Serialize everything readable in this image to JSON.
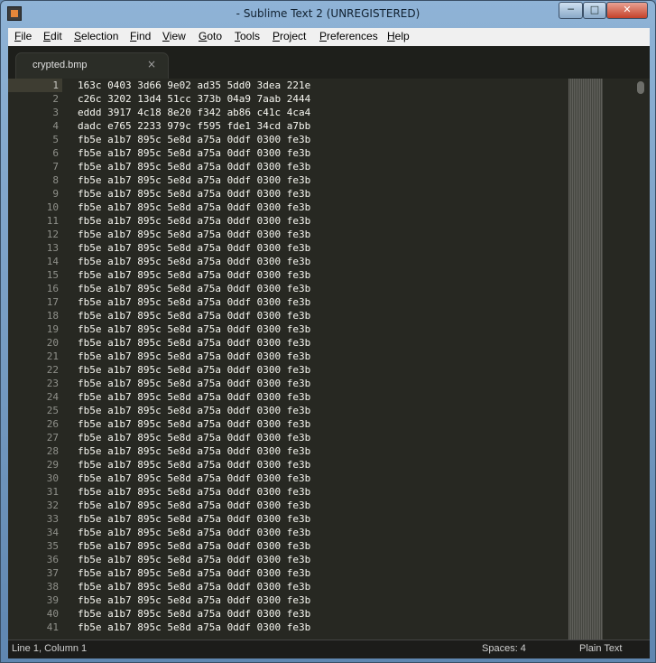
{
  "window": {
    "title": "- Sublime Text 2 (UNREGISTERED)",
    "controls": {
      "minimize": "─",
      "maximize": "□",
      "close": "✕"
    }
  },
  "menu": [
    {
      "label": "File",
      "mnemonic": "F",
      "rest": "ile"
    },
    {
      "label": "Edit",
      "mnemonic": "E",
      "rest": "dit"
    },
    {
      "label": "Selection",
      "mnemonic": "S",
      "rest": "election"
    },
    {
      "label": "Find",
      "mnemonic": "F",
      "rest": "ind"
    },
    {
      "label": "View",
      "mnemonic": "V",
      "rest": "iew"
    },
    {
      "label": "Goto",
      "mnemonic": "G",
      "rest": "oto"
    },
    {
      "label": "Tools",
      "mnemonic": "T",
      "rest": "ools"
    },
    {
      "label": "Project",
      "mnemonic": "P",
      "rest": "roject"
    },
    {
      "label": "Preferences",
      "mnemonic": "P",
      "rest": "references"
    },
    {
      "label": "Help",
      "mnemonic": "H",
      "rest": "elp"
    }
  ],
  "tab": {
    "label": "crypted.bmp",
    "close": "×"
  },
  "editor": {
    "lines": [
      {
        "n": "1",
        "text": "163c 0403 3d66 9e02 ad35 5dd0 3dea 221e"
      },
      {
        "n": "2",
        "text": "c26c 3202 13d4 51cc 373b 04a9 7aab 2444"
      },
      {
        "n": "3",
        "text": "eddd 3917 4c18 8e20 f342 ab86 c41c 4ca4"
      },
      {
        "n": "4",
        "text": "dadc e765 2233 979c f595 fde1 34cd a7bb"
      },
      {
        "n": "5",
        "text": "fb5e a1b7 895c 5e8d a75a 0ddf 0300 fe3b"
      },
      {
        "n": "6",
        "text": "fb5e a1b7 895c 5e8d a75a 0ddf 0300 fe3b"
      },
      {
        "n": "7",
        "text": "fb5e a1b7 895c 5e8d a75a 0ddf 0300 fe3b"
      },
      {
        "n": "8",
        "text": "fb5e a1b7 895c 5e8d a75a 0ddf 0300 fe3b"
      },
      {
        "n": "9",
        "text": "fb5e a1b7 895c 5e8d a75a 0ddf 0300 fe3b"
      },
      {
        "n": "10",
        "text": "fb5e a1b7 895c 5e8d a75a 0ddf 0300 fe3b"
      },
      {
        "n": "11",
        "text": "fb5e a1b7 895c 5e8d a75a 0ddf 0300 fe3b"
      },
      {
        "n": "12",
        "text": "fb5e a1b7 895c 5e8d a75a 0ddf 0300 fe3b"
      },
      {
        "n": "13",
        "text": "fb5e a1b7 895c 5e8d a75a 0ddf 0300 fe3b"
      },
      {
        "n": "14",
        "text": "fb5e a1b7 895c 5e8d a75a 0ddf 0300 fe3b"
      },
      {
        "n": "15",
        "text": "fb5e a1b7 895c 5e8d a75a 0ddf 0300 fe3b"
      },
      {
        "n": "16",
        "text": "fb5e a1b7 895c 5e8d a75a 0ddf 0300 fe3b"
      },
      {
        "n": "17",
        "text": "fb5e a1b7 895c 5e8d a75a 0ddf 0300 fe3b"
      },
      {
        "n": "18",
        "text": "fb5e a1b7 895c 5e8d a75a 0ddf 0300 fe3b"
      },
      {
        "n": "19",
        "text": "fb5e a1b7 895c 5e8d a75a 0ddf 0300 fe3b"
      },
      {
        "n": "20",
        "text": "fb5e a1b7 895c 5e8d a75a 0ddf 0300 fe3b"
      },
      {
        "n": "21",
        "text": "fb5e a1b7 895c 5e8d a75a 0ddf 0300 fe3b"
      },
      {
        "n": "22",
        "text": "fb5e a1b7 895c 5e8d a75a 0ddf 0300 fe3b"
      },
      {
        "n": "23",
        "text": "fb5e a1b7 895c 5e8d a75a 0ddf 0300 fe3b"
      },
      {
        "n": "24",
        "text": "fb5e a1b7 895c 5e8d a75a 0ddf 0300 fe3b"
      },
      {
        "n": "25",
        "text": "fb5e a1b7 895c 5e8d a75a 0ddf 0300 fe3b"
      },
      {
        "n": "26",
        "text": "fb5e a1b7 895c 5e8d a75a 0ddf 0300 fe3b"
      },
      {
        "n": "27",
        "text": "fb5e a1b7 895c 5e8d a75a 0ddf 0300 fe3b"
      },
      {
        "n": "28",
        "text": "fb5e a1b7 895c 5e8d a75a 0ddf 0300 fe3b"
      },
      {
        "n": "29",
        "text": "fb5e a1b7 895c 5e8d a75a 0ddf 0300 fe3b"
      },
      {
        "n": "30",
        "text": "fb5e a1b7 895c 5e8d a75a 0ddf 0300 fe3b"
      },
      {
        "n": "31",
        "text": "fb5e a1b7 895c 5e8d a75a 0ddf 0300 fe3b"
      },
      {
        "n": "32",
        "text": "fb5e a1b7 895c 5e8d a75a 0ddf 0300 fe3b"
      },
      {
        "n": "33",
        "text": "fb5e a1b7 895c 5e8d a75a 0ddf 0300 fe3b"
      },
      {
        "n": "34",
        "text": "fb5e a1b7 895c 5e8d a75a 0ddf 0300 fe3b"
      },
      {
        "n": "35",
        "text": "fb5e a1b7 895c 5e8d a75a 0ddf 0300 fe3b"
      },
      {
        "n": "36",
        "text": "fb5e a1b7 895c 5e8d a75a 0ddf 0300 fe3b"
      },
      {
        "n": "37",
        "text": "fb5e a1b7 895c 5e8d a75a 0ddf 0300 fe3b"
      },
      {
        "n": "38",
        "text": "fb5e a1b7 895c 5e8d a75a 0ddf 0300 fe3b"
      },
      {
        "n": "39",
        "text": "fb5e a1b7 895c 5e8d a75a 0ddf 0300 fe3b"
      },
      {
        "n": "40",
        "text": "fb5e a1b7 895c 5e8d a75a 0ddf 0300 fe3b"
      },
      {
        "n": "41",
        "text": "fb5e a1b7 895c 5e8d a75a 0ddf 0300 fe3b"
      }
    ]
  },
  "status": {
    "position": "Line 1, Column 1",
    "spaces": "Spaces: 4",
    "syntax": "Plain Text"
  },
  "colors": {
    "background": "#272822",
    "foreground": "#f8f8f2",
    "gutter": "#8f908a",
    "active_line": "#3e3d32"
  }
}
